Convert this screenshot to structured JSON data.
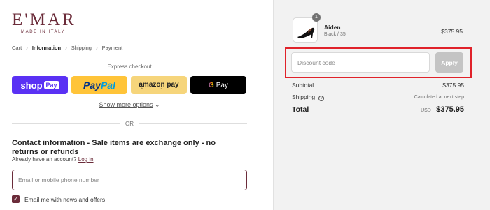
{
  "brand": {
    "name": "E'MAR",
    "tagline": "MADE IN ITALY"
  },
  "breadcrumb": {
    "items": [
      "Cart",
      "Information",
      "Shipping",
      "Payment"
    ],
    "separator": "›"
  },
  "express": {
    "title": "Express checkout",
    "buttons": {
      "shop_pay": {
        "text": "shop",
        "pill": "Pay"
      },
      "paypal": {
        "a": "Pay",
        "b": "Pal"
      },
      "amazon": "amazon pay",
      "gpay": {
        "g": "G",
        "text": "Pay"
      }
    },
    "show_more": "Show more options"
  },
  "divider": {
    "text": "OR"
  },
  "contact": {
    "title": "Contact information - Sale items are exchange only - no returns or refunds",
    "account_prompt": "Already have an account?",
    "login_link": "Log in",
    "email_placeholder": "Email or mobile phone number",
    "newsletter_label": "Email me with news and offers",
    "newsletter_checked": true
  },
  "summary": {
    "product": {
      "name": "Aiden",
      "variant": "Black / 35",
      "price": "$375.95",
      "quantity": "1"
    },
    "discount": {
      "placeholder": "Discount code",
      "button": "Apply"
    },
    "subtotal": {
      "label": "Subtotal",
      "value": "$375.95"
    },
    "shipping": {
      "label": "Shipping",
      "value": "Calculated at next step"
    },
    "total": {
      "label": "Total",
      "currency": "USD",
      "value": "$375.95"
    }
  },
  "colors": {
    "brand": "#6b2c3a",
    "highlight": "#e0222a",
    "shop_pay": "#5a31f4",
    "paypal": "#ffc439",
    "amazon": "#f6d57b"
  }
}
